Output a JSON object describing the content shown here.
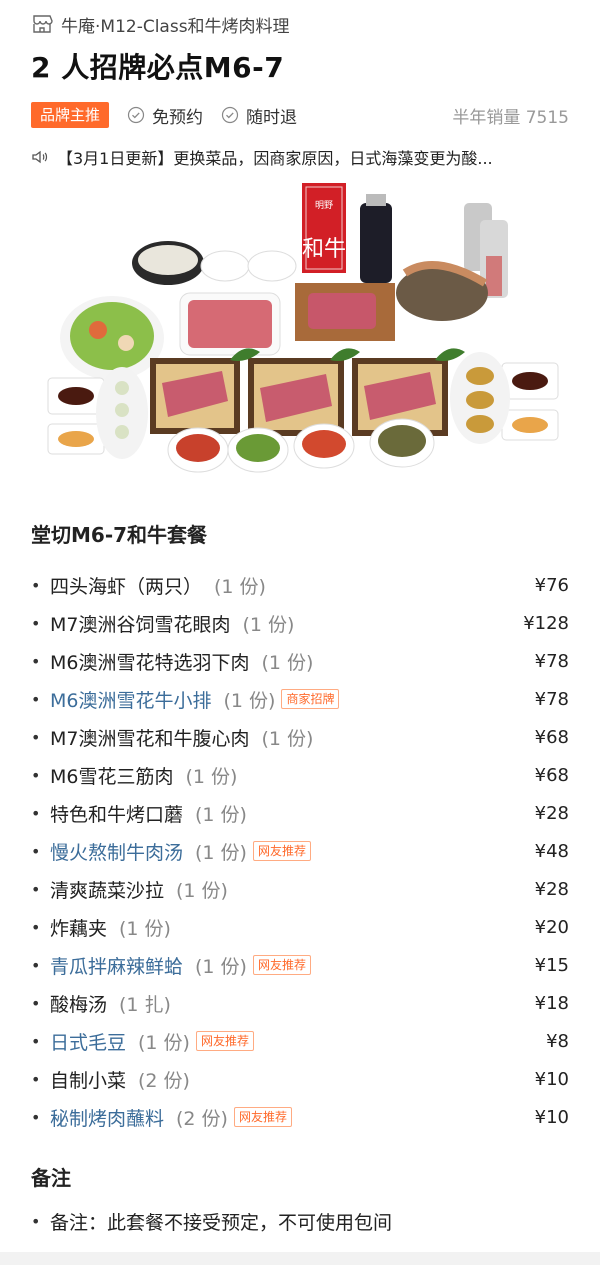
{
  "shop": {
    "name": "牛庵·M12-Class和牛烤肉料理",
    "icon": "store-icon"
  },
  "title": "2 人招牌必点M6-7",
  "badges": {
    "brand": "品牌主推",
    "no_reservation": "免预约",
    "refund_anytime": "随时退",
    "sales": "半年销量 7515"
  },
  "notice": "【3月1日更新】更换菜品，因商家原因，日式海藻变更为酸...",
  "photo": {
    "flag_text": "和牛",
    "flag_label": "明野"
  },
  "menu_section": {
    "title": "堂切M6-7和牛套餐",
    "items": [
      {
        "name": "四头海虾（两只）",
        "qty": "(1 份)",
        "price": "¥76",
        "tag": ""
      },
      {
        "name": "M7澳洲谷饲雪花眼肉",
        "qty": "(1 份)",
        "price": "¥128",
        "tag": ""
      },
      {
        "name": "M6澳洲雪花特选羽下肉",
        "qty": "(1 份)",
        "price": "¥78",
        "tag": ""
      },
      {
        "name": "M6澳洲雪花牛小排",
        "qty": "(1 份)",
        "price": "¥78",
        "tag": "商家招牌"
      },
      {
        "name": "M7澳洲雪花和牛腹心肉",
        "qty": "(1 份)",
        "price": "¥68",
        "tag": ""
      },
      {
        "name": "M6雪花三筋肉",
        "qty": "(1 份)",
        "price": "¥68",
        "tag": ""
      },
      {
        "name": "特色和牛烤口蘑",
        "qty": "(1 份)",
        "price": "¥28",
        "tag": ""
      },
      {
        "name": "慢火熬制牛肉汤",
        "qty": "(1 份)",
        "price": "¥48",
        "tag": "网友推荐"
      },
      {
        "name": "清爽蔬菜沙拉",
        "qty": "(1 份)",
        "price": "¥28",
        "tag": ""
      },
      {
        "name": "炸藕夹",
        "qty": "(1 份)",
        "price": "¥20",
        "tag": ""
      },
      {
        "name": "青瓜拌麻辣鲜蛤",
        "qty": "(1 份)",
        "price": "¥15",
        "tag": "网友推荐"
      },
      {
        "name": "酸梅汤",
        "qty": "(1 扎)",
        "price": "¥18",
        "tag": ""
      },
      {
        "name": "日式毛豆",
        "qty": "(1 份)",
        "price": "¥8",
        "tag": "网友推荐"
      },
      {
        "name": "自制小菜",
        "qty": "(2 份)",
        "price": "¥10",
        "tag": ""
      },
      {
        "name": "秘制烤肉蘸料",
        "qty": "(2 份)",
        "price": "¥10",
        "tag": "网友推荐"
      }
    ]
  },
  "remarks": {
    "title": "备注",
    "text": "备注：此套餐不接受预定，不可使用包间"
  },
  "colors": {
    "accent": "#ff6a2b",
    "link": "#3c6d9a",
    "muted": "#999999"
  }
}
